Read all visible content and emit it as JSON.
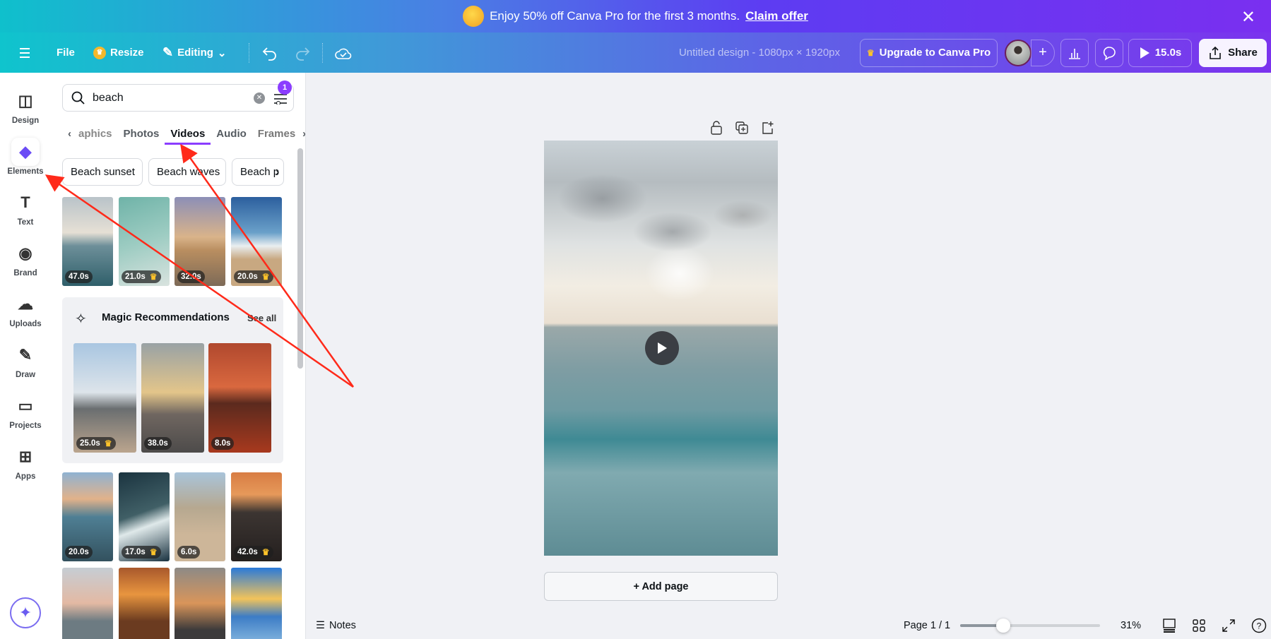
{
  "banner": {
    "text": "Enjoy 50% off Canva Pro for the first 3 months.",
    "link": "Claim offer"
  },
  "header": {
    "file": "File",
    "resize": "Resize",
    "editing": "Editing",
    "title": "Untitled design - 1080px × 1920px",
    "upgrade": "Upgrade to Canva Pro",
    "duration": "15.0s",
    "share": "Share"
  },
  "rail": [
    {
      "label": "Design",
      "icon": "layout-icon"
    },
    {
      "label": "Elements",
      "icon": "shapes-icon",
      "active": true
    },
    {
      "label": "Text",
      "icon": "text-icon"
    },
    {
      "label": "Brand",
      "icon": "brand-icon"
    },
    {
      "label": "Uploads",
      "icon": "cloud-upload-icon"
    },
    {
      "label": "Draw",
      "icon": "pen-icon"
    },
    {
      "label": "Projects",
      "icon": "folder-icon"
    },
    {
      "label": "Apps",
      "icon": "apps-icon"
    }
  ],
  "panel": {
    "search_value": "beach",
    "filter_count": "1",
    "tabs": [
      "aphics",
      "Photos",
      "Videos",
      "Audio",
      "Frames"
    ],
    "active_tab": "Videos",
    "chips": [
      "Beach sunset",
      "Beach waves",
      "Beach p"
    ],
    "videos_row1": [
      {
        "duration": "47.0s",
        "pro": false
      },
      {
        "duration": "21.0s",
        "pro": true
      },
      {
        "duration": "32.0s",
        "pro": false
      },
      {
        "duration": "20.0s",
        "pro": true
      }
    ],
    "magic": {
      "title": "Magic Recommendations",
      "see_all": "See all",
      "videos": [
        {
          "duration": "25.0s",
          "pro": true
        },
        {
          "duration": "38.0s",
          "pro": false
        },
        {
          "duration": "8.0s",
          "pro": false
        }
      ]
    },
    "videos_row3": [
      {
        "duration": "20.0s",
        "pro": false
      },
      {
        "duration": "17.0s",
        "pro": true
      },
      {
        "duration": "6.0s",
        "pro": false
      },
      {
        "duration": "42.0s",
        "pro": true
      }
    ]
  },
  "canvas": {
    "add_page": "+ Add page"
  },
  "footer": {
    "notes": "Notes",
    "page": "Page 1 / 1",
    "zoom": "31%",
    "zoom_percent": 31
  },
  "colors": {
    "accent": "#8b3dff",
    "annotation": "#ff2a1a"
  }
}
